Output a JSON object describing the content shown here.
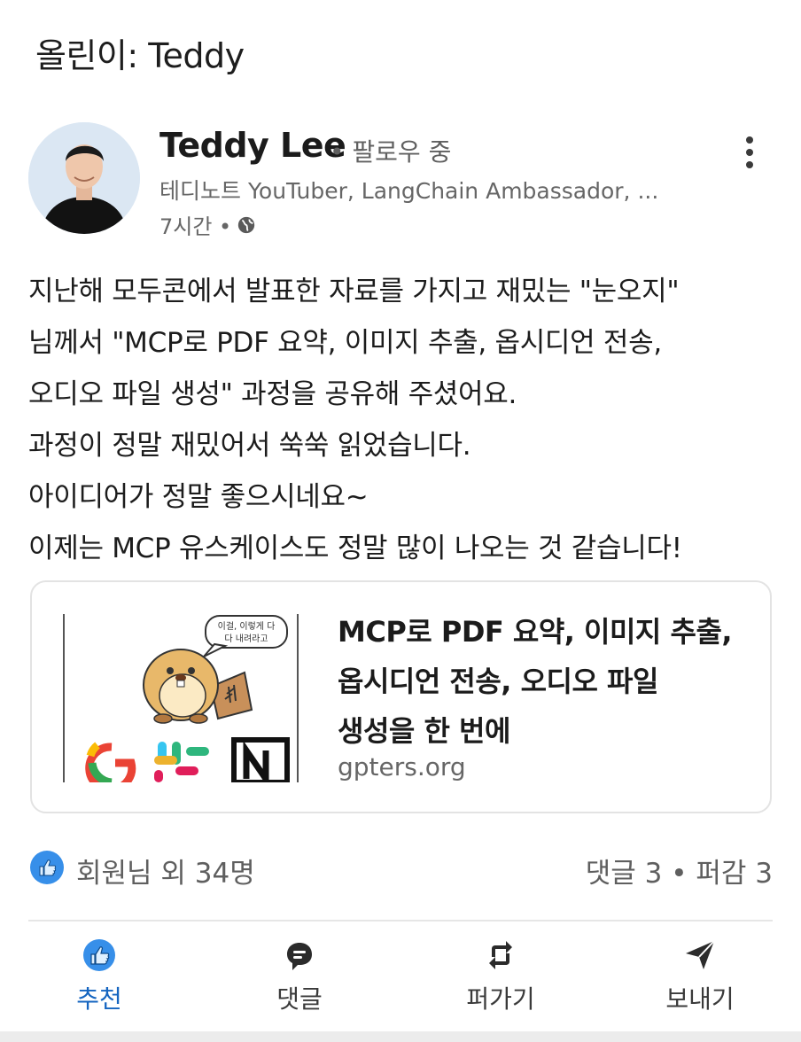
{
  "header": {
    "reposted_by": "올린이: Teddy"
  },
  "author": {
    "name": "Teddy Lee",
    "follow_status": "• 팔로우 중",
    "headline": "테디노트 YouTuber, LangChain Ambassador, ...",
    "time": "7시간 •"
  },
  "post": {
    "lines": [
      "지난해 모두콘에서 발표한 자료를 가지고 재밌는 \"눈오지\"",
      "님께서 \"MCP로 PDF 요약, 이미지 추출, 옵시디언 전송,",
      "오디오 파일 생성\" 과정을 공유해 주셨어요.",
      "과정이 정말 재밌어서 쑥쑥 읽었습니다.",
      "아이디어가 정말 좋으시네요~",
      "이제는 MCP 유스케이스도 정말 많이 나오는 것 같습니다!"
    ]
  },
  "link_card": {
    "title_lines": [
      "MCP로 PDF 요약, 이미지 추출,",
      "옵시디언 전송, 오디오 파일",
      "생성을 한 번에"
    ],
    "domain": "gpters.org",
    "thumb_bubble_lines": [
      "이걸, 이렇게 다",
      "다 내려라고"
    ]
  },
  "reactions": {
    "count_text": "회원님 외 34명",
    "stats_text": "댓글 3 • 퍼감 3"
  },
  "actions": {
    "like": "추천",
    "comment": "댓글",
    "repost": "퍼가기",
    "send": "보내기"
  },
  "colors": {
    "accent": "#1565c0",
    "like_blue": "#378fe9",
    "text_secondary": "#666666"
  },
  "icons": [
    "globe-icon",
    "more-icon",
    "like-icon",
    "comment-icon",
    "repost-icon",
    "send-icon"
  ]
}
